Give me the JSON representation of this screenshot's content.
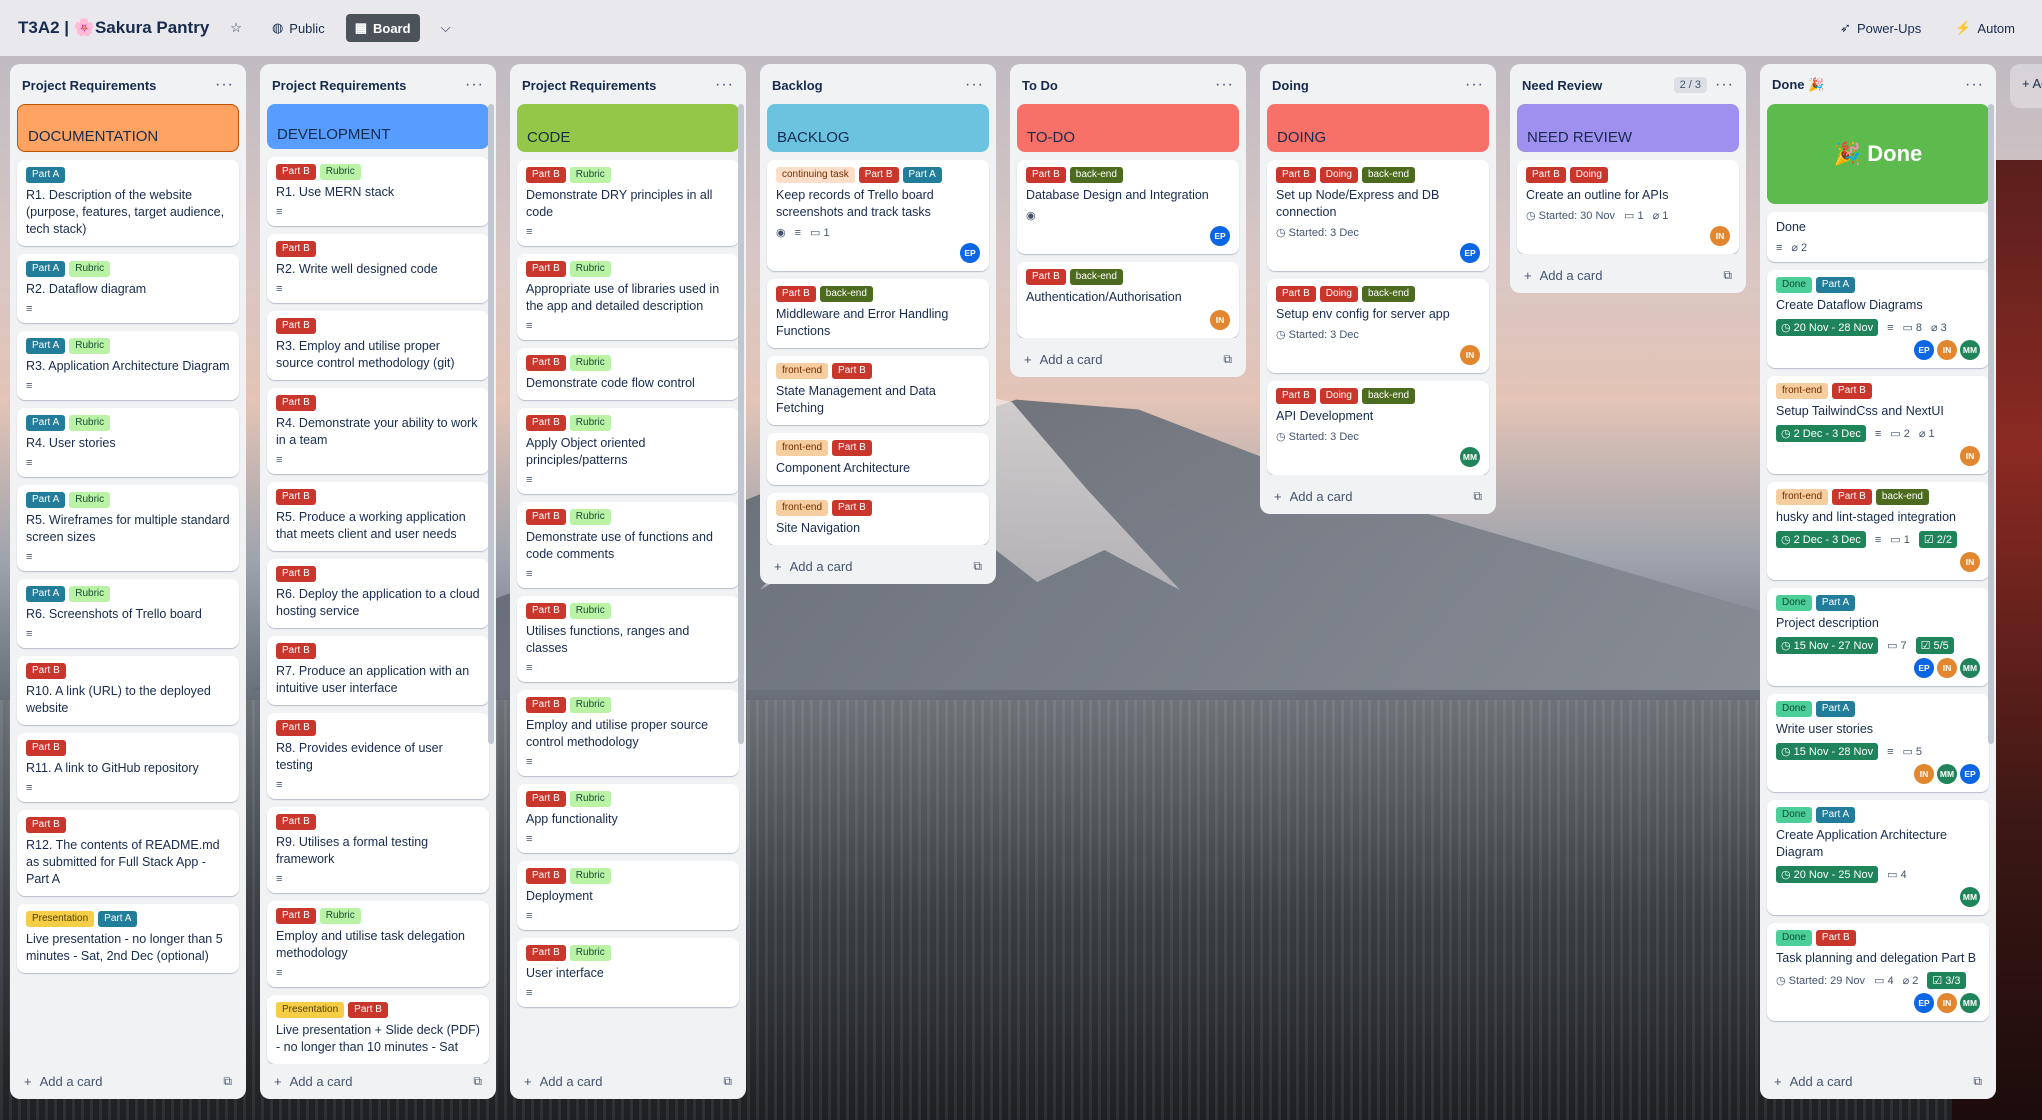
{
  "header": {
    "title": "T3A2 | 🌸Sakura Pantry",
    "visibility": "Public",
    "view": "Board",
    "powerups": "Power-Ups",
    "automation": "Autom"
  },
  "colors": {
    "partA": "#227d9b",
    "partB": "#c9372c",
    "rubric": "#baf3a6",
    "backend": "#4c6b1f",
    "frontend": "#f5cd9f",
    "doing": "#c9372c",
    "done_label": "#4bce97",
    "presentation": "#f5cd47",
    "continuing": "#fedec8",
    "av_EP": "#0c66e4",
    "av_IN": "#e2862f",
    "av_MM": "#1f845a"
  },
  "add_card": "Add a card",
  "add_list": "+ Ad",
  "lists": [
    {
      "title": "Project Requirements",
      "cover": {
        "text": "DOCUMENTATION",
        "color": "#fea362",
        "border": "#c25100"
      },
      "cards": [
        {
          "labels": [
            "Part A"
          ],
          "title": "R1. Description of the website (purpose, features, target audience, tech stack)"
        },
        {
          "labels": [
            "Part A",
            "Rubric"
          ],
          "title": "R2. Dataflow diagram",
          "desc": true
        },
        {
          "labels": [
            "Part A",
            "Rubric"
          ],
          "title": "R3. Application Architecture Diagram",
          "desc": true
        },
        {
          "labels": [
            "Part A",
            "Rubric"
          ],
          "title": "R4. User stories",
          "desc": true
        },
        {
          "labels": [
            "Part A",
            "Rubric"
          ],
          "title": "R5. Wireframes for multiple standard screen sizes",
          "desc": true
        },
        {
          "labels": [
            "Part A",
            "Rubric"
          ],
          "title": "R6. Screenshots of Trello board",
          "desc": true
        },
        {
          "labels": [
            "Part B"
          ],
          "title": "R10. A link (URL) to the deployed website"
        },
        {
          "labels": [
            "Part B"
          ],
          "title": "R11. A link to GitHub repository",
          "desc": true
        },
        {
          "labels": [
            "Part B"
          ],
          "title": "R12. The contents of README.md as submitted for Full Stack App - Part A"
        },
        {
          "labels": [
            "Presentation",
            "Part A"
          ],
          "title": "Live presentation - no longer than 5 minutes - Sat, 2nd Dec (optional)"
        }
      ]
    },
    {
      "title": "Project Requirements",
      "cover": {
        "text": "DEVELOPMENT",
        "color": "#579dff"
      },
      "cards": [
        {
          "labels": [
            "Part B",
            "Rubric"
          ],
          "title": "R1. Use MERN stack",
          "desc": true
        },
        {
          "labels": [
            "Part B"
          ],
          "title": "R2. Write well designed code",
          "desc": true
        },
        {
          "labels": [
            "Part B"
          ],
          "title": "R3. Employ and utilise proper source control methodology (git)"
        },
        {
          "labels": [
            "Part B"
          ],
          "title": "R4. Demonstrate your ability to work in a team",
          "desc": true
        },
        {
          "labels": [
            "Part B"
          ],
          "title": "R5. Produce a working application that meets client and user needs"
        },
        {
          "labels": [
            "Part B"
          ],
          "title": "R6. Deploy the application to a cloud hosting service"
        },
        {
          "labels": [
            "Part B"
          ],
          "title": "R7. Produce an application with an intuitive user interface"
        },
        {
          "labels": [
            "Part B"
          ],
          "title": "R8. Provides evidence of user testing",
          "desc": true
        },
        {
          "labels": [
            "Part B"
          ],
          "title": "R9. Utilises a formal testing framework",
          "desc": true
        },
        {
          "labels": [
            "Part B",
            "Rubric"
          ],
          "title": "Employ and utilise task delegation methodology",
          "desc": true
        },
        {
          "labels": [
            "Presentation",
            "Part B"
          ],
          "title": "Live presentation + Slide deck (PDF) - no longer than 10 minutes - Sat"
        }
      ]
    },
    {
      "title": "Project Requirements",
      "cover": {
        "text": "CODE",
        "color": "#94c748"
      },
      "cards": [
        {
          "labels": [
            "Part B",
            "Rubric"
          ],
          "title": "Demonstrate DRY principles in all code",
          "desc": true
        },
        {
          "labels": [
            "Part B",
            "Rubric"
          ],
          "title": "Appropriate use of libraries used in the app and detailed description",
          "desc": true
        },
        {
          "labels": [
            "Part B",
            "Rubric"
          ],
          "title": "Demonstrate code flow control"
        },
        {
          "labels": [
            "Part B",
            "Rubric"
          ],
          "title": "Apply Object oriented principles/patterns",
          "desc": true
        },
        {
          "labels": [
            "Part B",
            "Rubric"
          ],
          "title": "Demonstrate use of functions and code comments",
          "desc": true
        },
        {
          "labels": [
            "Part B",
            "Rubric"
          ],
          "title": "Utilises functions, ranges and classes",
          "desc": true
        },
        {
          "labels": [
            "Part B",
            "Rubric"
          ],
          "title": "Employ and utilise proper source control methodology",
          "desc": true
        },
        {
          "labels": [
            "Part B",
            "Rubric"
          ],
          "title": "App functionality",
          "desc": true
        },
        {
          "labels": [
            "Part B",
            "Rubric"
          ],
          "title": "Deployment",
          "desc": true
        },
        {
          "labels": [
            "Part B",
            "Rubric"
          ],
          "title": "User interface",
          "desc": true
        }
      ]
    },
    {
      "title": "Backlog",
      "cover": {
        "text": "BACKLOG",
        "color": "#6cc3e0"
      },
      "cards": [
        {
          "labels": [
            "continuing task",
            "Part B",
            "Part A"
          ],
          "title": "Keep records of Trello board screenshots and track tasks",
          "watch": true,
          "desc": true,
          "comments": "1",
          "members": [
            "EP"
          ]
        },
        {
          "labels": [
            "Part B",
            "back-end"
          ],
          "title": "Middleware and Error Handling Functions"
        },
        {
          "labels": [
            "front-end",
            "Part B"
          ],
          "title": "State Management and Data Fetching"
        },
        {
          "labels": [
            "front-end",
            "Part B"
          ],
          "title": "Component Architecture"
        },
        {
          "labels": [
            "front-end",
            "Part B"
          ],
          "title": "Site Navigation"
        }
      ]
    },
    {
      "title": "To Do",
      "cover": {
        "text": "TO-DO",
        "color": "#f87168"
      },
      "cards": [
        {
          "labels": [
            "Part B",
            "back-end"
          ],
          "title": "Database Design and Integration",
          "watch": true,
          "members": [
            "EP"
          ]
        },
        {
          "labels": [
            "Part B",
            "back-end"
          ],
          "title": "Authentication/Authorisation",
          "members": [
            "IN"
          ]
        }
      ]
    },
    {
      "title": "Doing",
      "cover": {
        "text": "DOING",
        "color": "#f87168"
      },
      "cards": [
        {
          "labels": [
            "Part B",
            "Doing",
            "back-end"
          ],
          "title": "Set up Node/Express and DB connection",
          "started": "Started: 3 Dec",
          "members": [
            "EP"
          ]
        },
        {
          "labels": [
            "Part B",
            "Doing",
            "back-end"
          ],
          "title": "Setup env config for server app",
          "started": "Started: 3 Dec",
          "members": [
            "IN"
          ]
        },
        {
          "labels": [
            "Part B",
            "Doing",
            "back-end"
          ],
          "title": "API Development",
          "started": "Started: 3 Dec",
          "members": [
            "MM"
          ]
        }
      ]
    },
    {
      "title": "Need Review",
      "count": "2 / 3",
      "cover": {
        "text": "NEED REVIEW",
        "color": "#9f8fef"
      },
      "cards": [
        {
          "labels": [
            "Part B",
            "Doing"
          ],
          "title": "Create an outline for APIs",
          "started": "Started: 30 Nov",
          "comments": "1",
          "attachments": "1",
          "members": [
            "IN"
          ]
        }
      ]
    },
    {
      "title": "Done 🎉",
      "cover": {
        "text": "🎉 Done",
        "color": "#5dbb4d"
      },
      "cards": [
        {
          "labels": [],
          "title": "Done",
          "desc": true,
          "attachments": "2"
        },
        {
          "labels": [
            "Done",
            "Part A"
          ],
          "title": "Create Dataflow Diagrams",
          "date": "20 Nov - 28 Nov",
          "desc": true,
          "comments": "8",
          "attachments": "3",
          "members": [
            "EP",
            "IN",
            "MM"
          ]
        },
        {
          "labels": [
            "front-end",
            "Part B"
          ],
          "title": "Setup TailwindCss and NextUI",
          "date": "2 Dec - 3 Dec",
          "desc": true,
          "comments": "2",
          "attachments": "1",
          "members": [
            "IN"
          ]
        },
        {
          "labels": [
            "front-end",
            "Part B",
            "back-end"
          ],
          "title": "husky and lint-staged integration",
          "date": "2 Dec - 3 Dec",
          "desc": true,
          "comments": "1",
          "checklist": "2/2",
          "members": [
            "IN"
          ]
        },
        {
          "labels": [
            "Done",
            "Part A"
          ],
          "title": "Project description",
          "date": "15 Nov - 27 Nov",
          "comments": "7",
          "checklist": "5/5",
          "members": [
            "EP",
            "IN",
            "MM"
          ]
        },
        {
          "labels": [
            "Done",
            "Part A"
          ],
          "title": "Write user stories",
          "date": "15 Nov - 28 Nov",
          "desc": true,
          "comments": "5",
          "members": [
            "IN",
            "MM",
            "EP"
          ]
        },
        {
          "labels": [
            "Done",
            "Part A"
          ],
          "title": "Create Application Architecture Diagram",
          "date": "20 Nov - 25 Nov",
          "comments": "4",
          "members": [
            "MM"
          ]
        },
        {
          "labels": [
            "Done",
            "Part B"
          ],
          "title": "Task planning and delegation Part B",
          "started": "Started: 29 Nov",
          "comments": "4",
          "attachments": "2",
          "checklist": "3/3",
          "members": [
            "EP",
            "IN",
            "MM"
          ]
        }
      ]
    }
  ]
}
